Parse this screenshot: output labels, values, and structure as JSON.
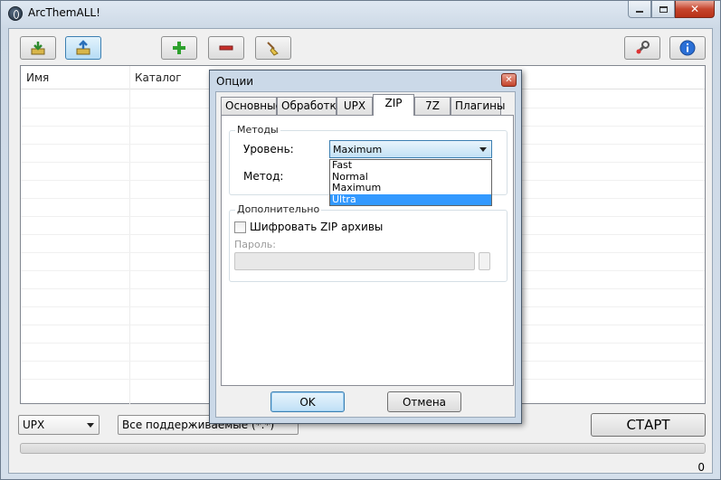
{
  "window": {
    "title": "ArcThemALL!",
    "caption": {
      "minimize": "▭",
      "maximize": "◻",
      "close": "✕"
    }
  },
  "toolbar": {
    "icons": [
      "extract-icon",
      "compress-icon",
      "add-icon",
      "remove-icon",
      "clean-icon",
      "settings-icon",
      "info-icon"
    ],
    "accent": "#3c7fb1"
  },
  "list": {
    "columns": [
      "Имя",
      "Каталог"
    ]
  },
  "bottom": {
    "mode_value": "UPX",
    "filter_value": "Все поддерживаемые (*.*)",
    "start_label": "СТАРТ",
    "progress": 0,
    "count": "0"
  },
  "dialog": {
    "title": "Опции",
    "tabs": [
      "Основные",
      "Обработка",
      "UPX",
      "ZIP",
      "7Z",
      "Плагины"
    ],
    "selected_tab": "ZIP",
    "methods_group": "Методы",
    "level_label": "Уровень:",
    "level_value": "Maximum",
    "level_options": [
      "Fast",
      "Normal",
      "Maximum",
      "Ultra"
    ],
    "highlighted_option": "Ultra",
    "method_label": "Метод:",
    "extra_group": "Дополнительно",
    "encrypt_label": "Шифровать ZIP архивы",
    "encrypt_checked": false,
    "password_label": "Пароль:",
    "ok_label": "OK",
    "cancel_label": "Отмена"
  }
}
